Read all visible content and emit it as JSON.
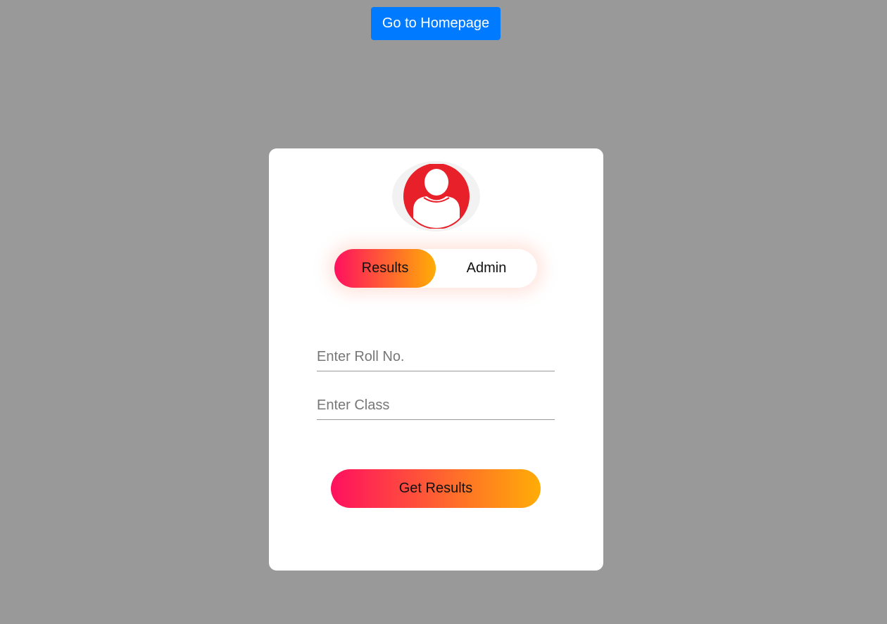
{
  "header": {
    "home_button_label": "Go to Homepage"
  },
  "card": {
    "avatar_icon": "user-avatar-icon",
    "toggle": {
      "options": [
        {
          "label": "Results",
          "active": true
        },
        {
          "label": "Admin",
          "active": false
        }
      ]
    },
    "form": {
      "roll_placeholder": "Enter Roll No.",
      "roll_value": "",
      "class_placeholder": "Enter Class",
      "class_value": "",
      "submit_label": "Get Results"
    }
  },
  "colors": {
    "background": "#999999",
    "home_button": "#007bff",
    "gradient_start": "#ff105f",
    "gradient_end": "#ffad06",
    "avatar_red": "#e8202a"
  }
}
